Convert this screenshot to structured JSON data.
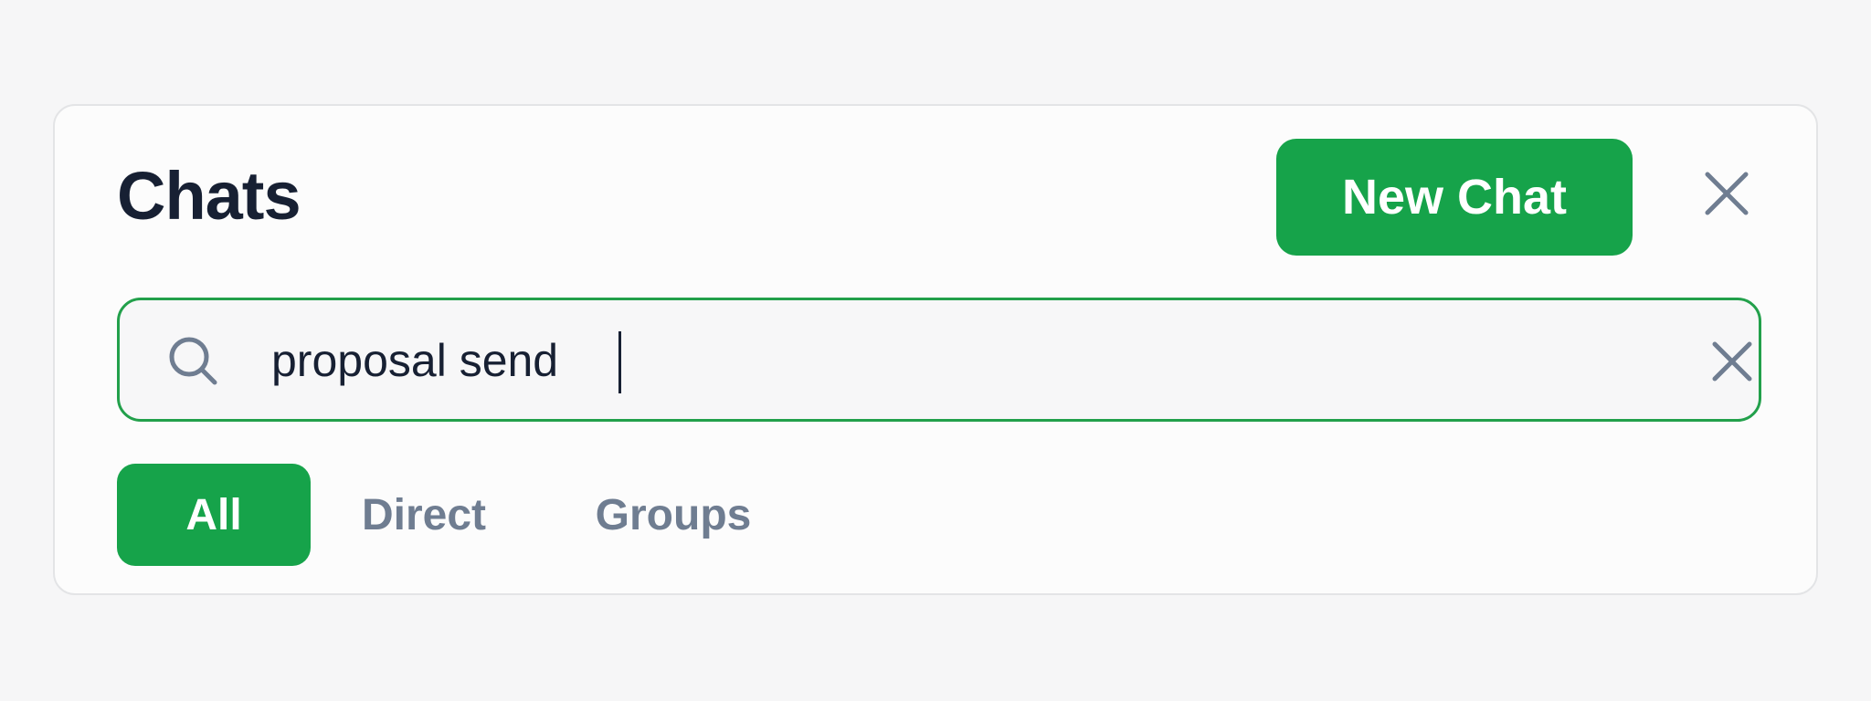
{
  "header": {
    "title": "Chats",
    "new_chat_label": "New Chat",
    "close_icon": "close-icon"
  },
  "search": {
    "value": "proposal send",
    "placeholder": "",
    "icon": "search-icon",
    "clear_icon": "clear-icon"
  },
  "tabs": [
    {
      "label": "All",
      "active": true
    },
    {
      "label": "Direct",
      "active": false
    },
    {
      "label": "Groups",
      "active": false
    }
  ],
  "colors": {
    "accent": "#16a34a",
    "title": "#172033",
    "muted": "#6f7d91",
    "search_border": "#22a04b"
  }
}
